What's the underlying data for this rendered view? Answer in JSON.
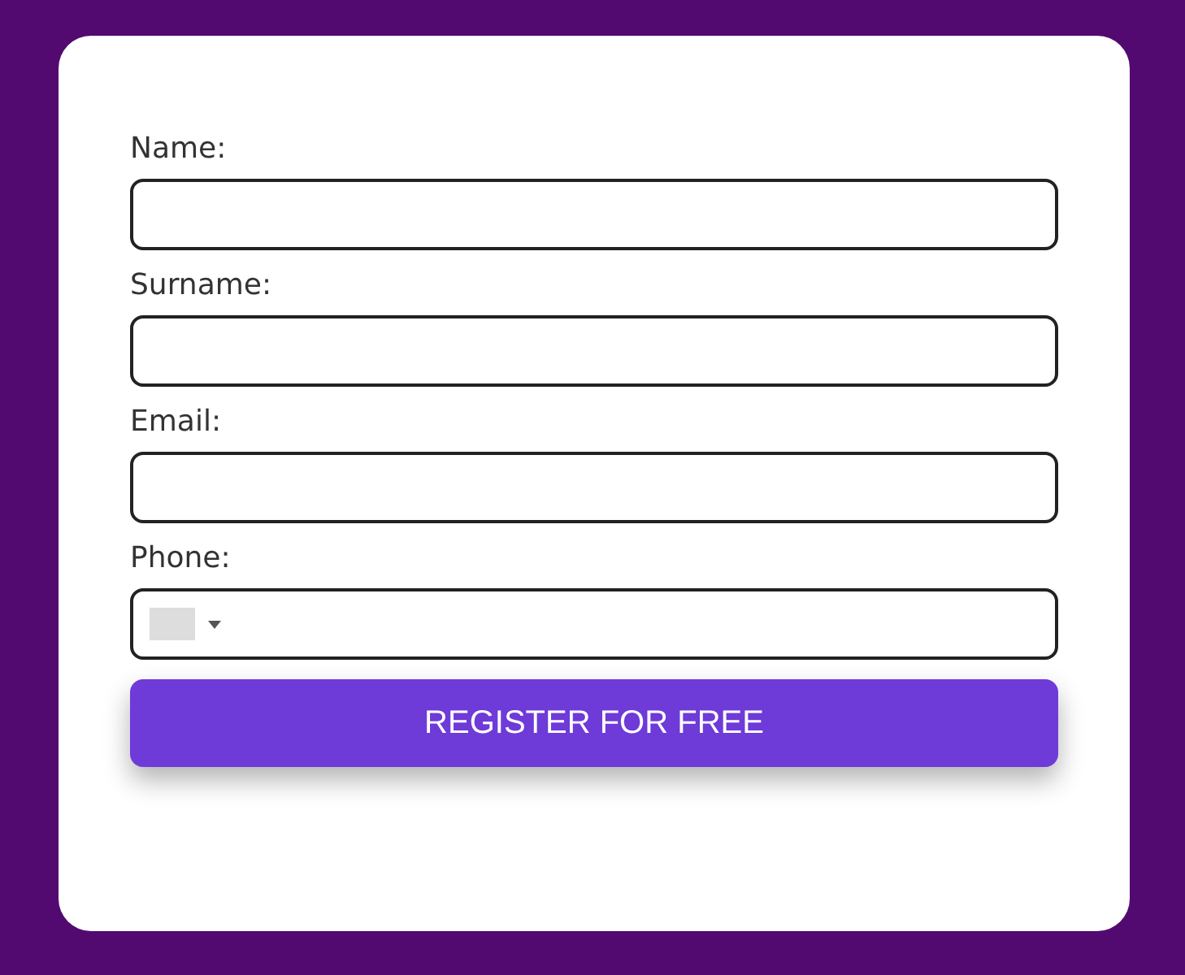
{
  "form": {
    "fields": [
      {
        "label": "Name:",
        "kind": "text"
      },
      {
        "label": "Surname:",
        "kind": "text"
      },
      {
        "label": "Email:",
        "kind": "text"
      },
      {
        "label": "Phone:",
        "kind": "phone"
      }
    ],
    "submit": {
      "label": "REGISTER FOR FREE"
    }
  }
}
